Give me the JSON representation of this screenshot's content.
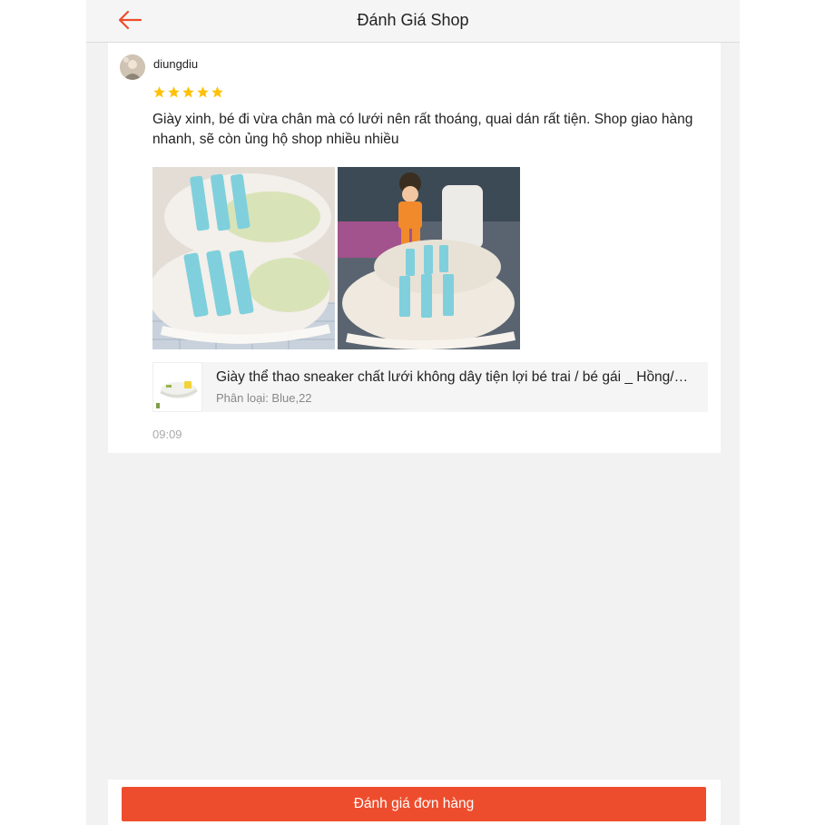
{
  "header": {
    "title": "Đánh Giá Shop",
    "back_icon": "arrow-left-icon",
    "accent_color": "#ee4d2d"
  },
  "review": {
    "username": "diungdiu",
    "rating": 5,
    "rating_max": 5,
    "comment": "Giày xinh, bé đi vừa chân mà có lưới nên rất thoáng, quai dán rất tiện. Shop giao hàng nhanh, sẽ còn ủng hộ shop nhiều nhiều",
    "photos": [
      "sneaker-photo-1",
      "sneaker-photo-2"
    ],
    "product": {
      "name": "Giày thể thao sneaker chất lưới không dây tiện lợi bé trai / bé gái _ Hồng/Xanh/Vàng",
      "variant": "Phân loại: Blue,22"
    },
    "time": "09:09"
  },
  "footer": {
    "button_label": "Đánh giá đơn hàng"
  }
}
